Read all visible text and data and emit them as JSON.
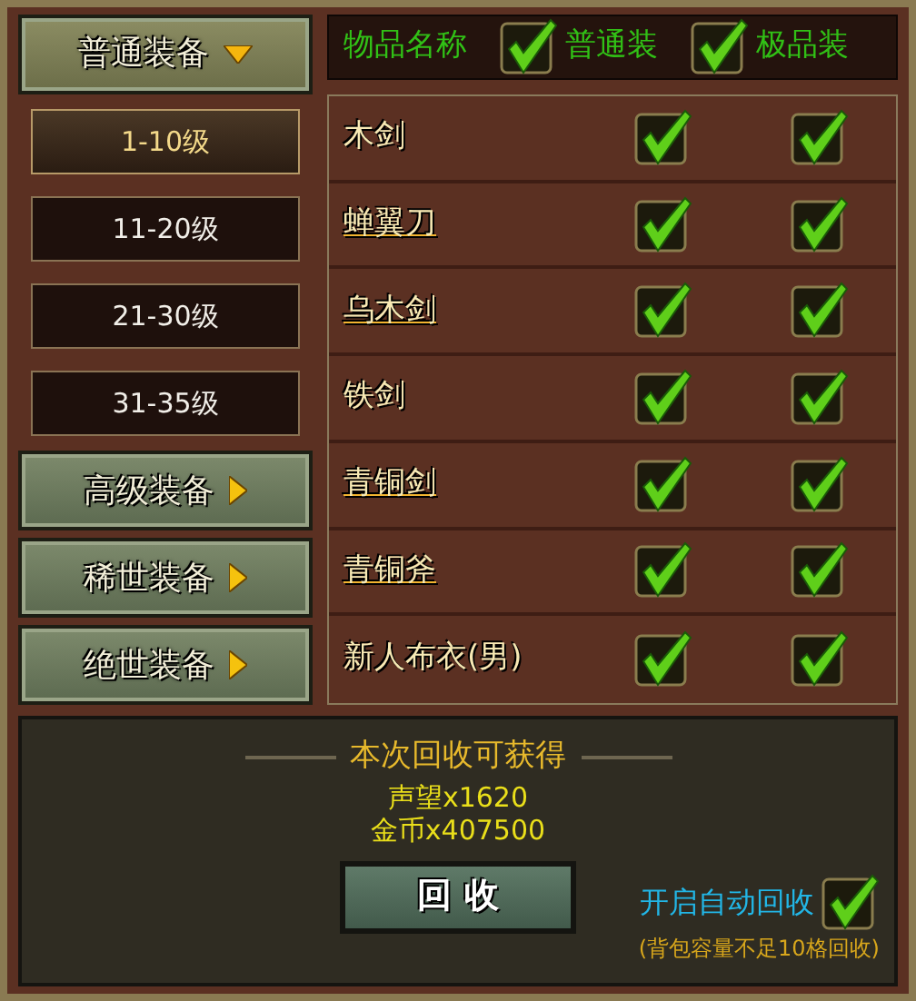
{
  "categories": [
    {
      "label": "普通装备",
      "expanded": true,
      "children": [
        {
          "label": "1-10级",
          "selected": true
        },
        {
          "label": "11-20级",
          "selected": false
        },
        {
          "label": "21-30级",
          "selected": false
        },
        {
          "label": "31-35级",
          "selected": false
        }
      ]
    },
    {
      "label": "高级装备",
      "expanded": false
    },
    {
      "label": "稀世装备",
      "expanded": false
    },
    {
      "label": "绝世装备",
      "expanded": false
    }
  ],
  "table": {
    "columns": [
      {
        "label": "物品名称"
      },
      {
        "label": "普通装",
        "checked": true
      },
      {
        "label": "极品装",
        "checked": true
      }
    ],
    "rows": [
      {
        "name": "木剑",
        "kind": "plain",
        "normal": true,
        "premium": true
      },
      {
        "name": "蝉翼刀",
        "kind": "link",
        "normal": true,
        "premium": true
      },
      {
        "name": "乌木剑",
        "kind": "link",
        "normal": true,
        "premium": true
      },
      {
        "name": "铁剑",
        "kind": "plain",
        "normal": true,
        "premium": true
      },
      {
        "name": "青铜剑",
        "kind": "link",
        "normal": true,
        "premium": true
      },
      {
        "name": "青铜斧",
        "kind": "link",
        "normal": true,
        "premium": true
      },
      {
        "name": "新人布衣(男)",
        "kind": "plain",
        "normal": true,
        "premium": true
      }
    ]
  },
  "reward": {
    "title": "本次回收可获得",
    "lines": [
      "声望x1620",
      "金币x407500"
    ],
    "button": "回 收",
    "auto": {
      "label": "开启自动回收",
      "checked": true
    },
    "note": "(背包容量不足10格回收)"
  }
}
